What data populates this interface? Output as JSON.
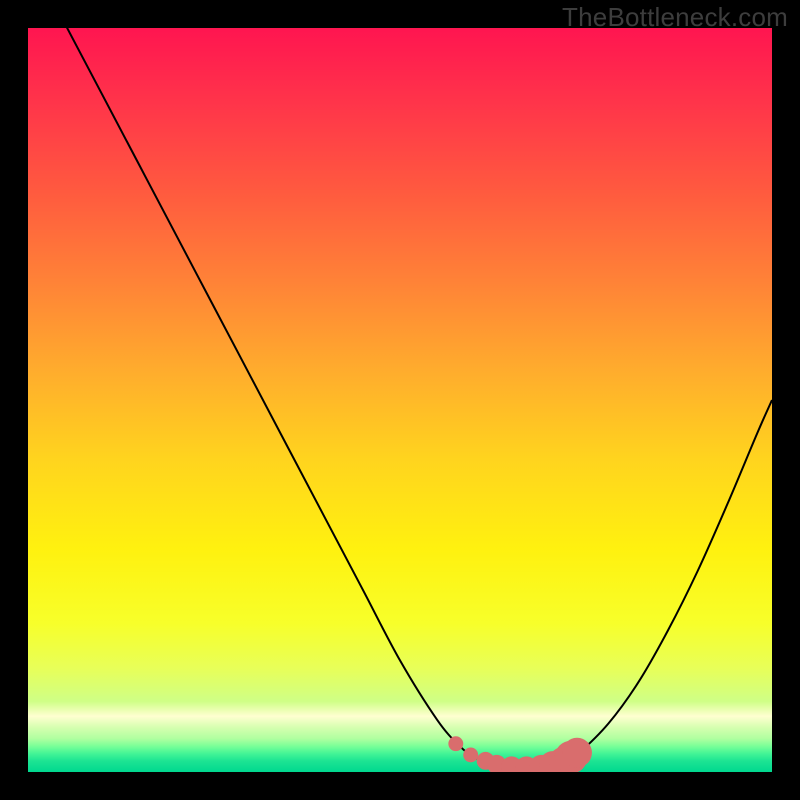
{
  "watermark": "TheBottleneck.com",
  "colors": {
    "frame_bg": "#000000",
    "curve_stroke": "#000000",
    "marker_fill": "#d96d6d",
    "gradient_stops": [
      {
        "offset": 0.0,
        "color": "#ff1550"
      },
      {
        "offset": 0.1,
        "color": "#ff344a"
      },
      {
        "offset": 0.22,
        "color": "#ff5a3f"
      },
      {
        "offset": 0.34,
        "color": "#ff8237"
      },
      {
        "offset": 0.46,
        "color": "#ffac2d"
      },
      {
        "offset": 0.58,
        "color": "#ffd41e"
      },
      {
        "offset": 0.7,
        "color": "#fff10f"
      },
      {
        "offset": 0.8,
        "color": "#f7ff2a"
      },
      {
        "offset": 0.86,
        "color": "#e8ff58"
      },
      {
        "offset": 0.905,
        "color": "#cfff86"
      },
      {
        "offset": 0.925,
        "color": "#ffffd0"
      },
      {
        "offset": 0.94,
        "color": "#d6ffb0"
      },
      {
        "offset": 0.955,
        "color": "#b0ffa0"
      },
      {
        "offset": 0.965,
        "color": "#7aff98"
      },
      {
        "offset": 0.975,
        "color": "#44f596"
      },
      {
        "offset": 0.985,
        "color": "#1de493"
      },
      {
        "offset": 1.0,
        "color": "#00d88f"
      }
    ]
  },
  "chart_data": {
    "type": "line",
    "title": "",
    "xlabel": "",
    "ylabel": "",
    "xlim": [
      0,
      100
    ],
    "ylim": [
      0,
      100
    ],
    "series": [
      {
        "name": "bottleneck-curve",
        "x": [
          0,
          5,
          10,
          15,
          20,
          25,
          30,
          35,
          40,
          45,
          50,
          55,
          58,
          60,
          62,
          64,
          66,
          68,
          70,
          72,
          74,
          78,
          82,
          86,
          90,
          94,
          98,
          100
        ],
        "y": [
          110,
          100.5,
          91,
          81.5,
          72,
          62.5,
          53,
          43.5,
          34,
          24.5,
          15,
          7,
          3.5,
          2,
          1.2,
          0.8,
          0.6,
          0.6,
          0.8,
          1.2,
          2.5,
          6.5,
          12,
          19,
          27,
          36,
          45.5,
          50
        ]
      }
    ],
    "markers": {
      "name": "highlight-markers",
      "points": [
        {
          "x": 57.5,
          "y": 3.8,
          "r": 1.0
        },
        {
          "x": 59.5,
          "y": 2.3,
          "r": 1.0
        },
        {
          "x": 61.5,
          "y": 1.5,
          "r": 1.2
        },
        {
          "x": 63.0,
          "y": 1.0,
          "r": 1.3
        },
        {
          "x": 65.0,
          "y": 0.7,
          "r": 1.4
        },
        {
          "x": 67.0,
          "y": 0.6,
          "r": 1.5
        },
        {
          "x": 69.0,
          "y": 0.7,
          "r": 1.6
        },
        {
          "x": 70.5,
          "y": 1.0,
          "r": 1.8
        },
        {
          "x": 72.0,
          "y": 1.4,
          "r": 2.0
        },
        {
          "x": 73.0,
          "y": 2.0,
          "r": 2.2
        },
        {
          "x": 73.8,
          "y": 2.6,
          "r": 2.0
        }
      ]
    }
  }
}
